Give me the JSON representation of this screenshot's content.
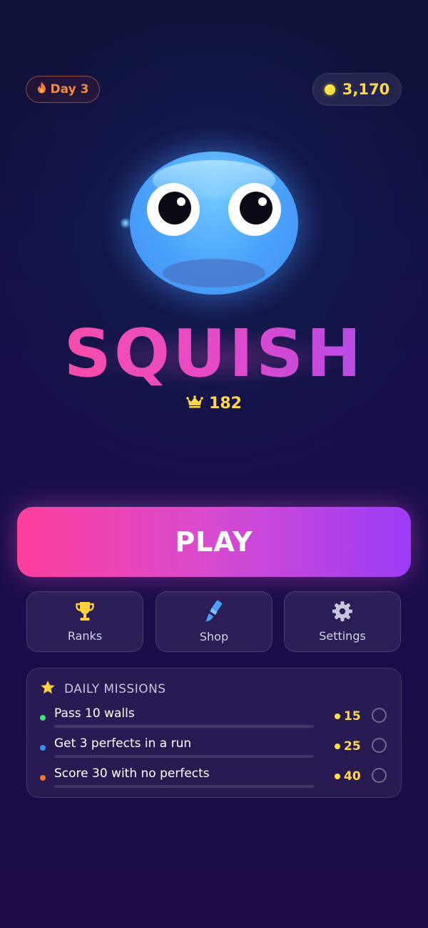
{
  "status_bar": {
    "streak_label": "Day 3",
    "streak_icon": "flame-icon",
    "coins": "3,170",
    "coin_color": "#ffe144"
  },
  "hero": {
    "title": "SQUISH",
    "best_score": "182",
    "best_icon": "crown-icon"
  },
  "actions": {
    "play_label": "PLAY",
    "ranks_label": "Ranks",
    "shop_label": "Shop",
    "settings_label": "Settings"
  },
  "missions": {
    "heading": "DAILY MISSIONS",
    "items": [
      {
        "label": "Pass 10 walls",
        "reward": "15",
        "dot_color": "#3ee07a",
        "progress": 0
      },
      {
        "label": "Get 3 perfects in a run",
        "reward": "25",
        "dot_color": "#3f8ef4",
        "progress": 0
      },
      {
        "label": "Score 30 with no perfects",
        "reward": "40",
        "dot_color": "#f5732e",
        "progress": 0
      }
    ]
  },
  "colors": {
    "accent_pink": "#ff3f9c",
    "accent_purple": "#9c3cf8",
    "gold": "#ffd84a",
    "streak_orange": "#f08a4b",
    "blob_blue": "#4aa2fa"
  }
}
